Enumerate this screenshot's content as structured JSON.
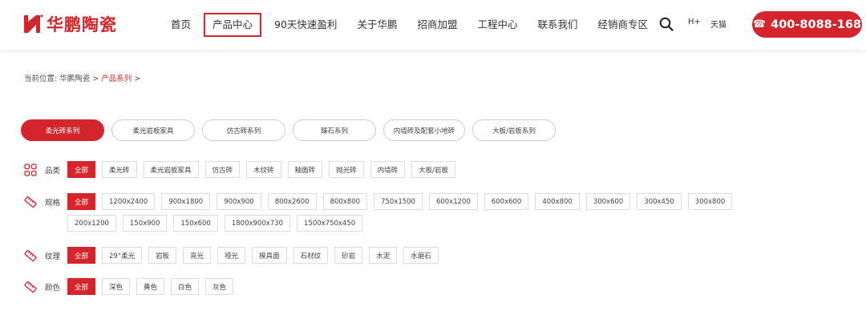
{
  "header": {
    "brand": "华鹏陶瓷",
    "logo_letter": "H",
    "nav": [
      {
        "label": "首页",
        "active": false
      },
      {
        "label": "产品中心",
        "active": true
      },
      {
        "label": "90天快速盈利",
        "active": false
      },
      {
        "label": "关于华鹏",
        "active": false
      },
      {
        "label": "招商加盟",
        "active": false
      },
      {
        "label": "工程中心",
        "active": false
      },
      {
        "label": "联系我们",
        "active": false
      },
      {
        "label": "经销商专区",
        "active": false
      }
    ],
    "hplus": "H+",
    "tmall": "天猫",
    "phone_icon": "☎",
    "phone": "400-8088-168"
  },
  "breadcrumb": {
    "prefix": "当前位置:",
    "home": "华鹏陶瓷",
    "sep": ">",
    "current": "产品系列",
    "sep2": ">"
  },
  "series_tabs": [
    {
      "label": "柔光砖系列",
      "active": true
    },
    {
      "label": "柔光岩板家具",
      "active": false
    },
    {
      "label": "仿古砖系列",
      "active": false
    },
    {
      "label": "臻石系列",
      "active": false
    },
    {
      "label": "内墙砖及配套小地砖",
      "active": false
    },
    {
      "label": "大板/岩板系列",
      "active": false
    }
  ],
  "filters": {
    "category": {
      "label": "品类",
      "icon": "grid-icon",
      "options": [
        "全部",
        "柔光砖",
        "柔光岩板家具",
        "仿古砖",
        "木纹砖",
        "釉面砖",
        "抛光砖",
        "内墙砖",
        "大板/岩板"
      ]
    },
    "spec": {
      "label": "规格",
      "icon": "ruler-icon",
      "options": [
        "全部",
        "1200x2400",
        "900x1800",
        "900x900",
        "800x2600",
        "800x800",
        "750x1500",
        "600x1200",
        "600x600",
        "400x800",
        "300x600",
        "300x450",
        "300x800",
        "200x1200",
        "150x900",
        "150x600",
        "1800x900x730",
        "1500x750x450"
      ]
    },
    "texture": {
      "label": "纹理",
      "icon": "ruler-icon",
      "options": [
        "全部",
        "29°柔光",
        "岩板",
        "亮光",
        "哑光",
        "模具面",
        "石材纹",
        "砂岩",
        "水泥",
        "水磨石"
      ]
    },
    "color": {
      "label": "颜色",
      "icon": "ruler-icon",
      "options": [
        "全部",
        "深色",
        "黄色",
        "白色",
        "灰色"
      ]
    }
  },
  "colors": {
    "accent": "#d3252b"
  }
}
